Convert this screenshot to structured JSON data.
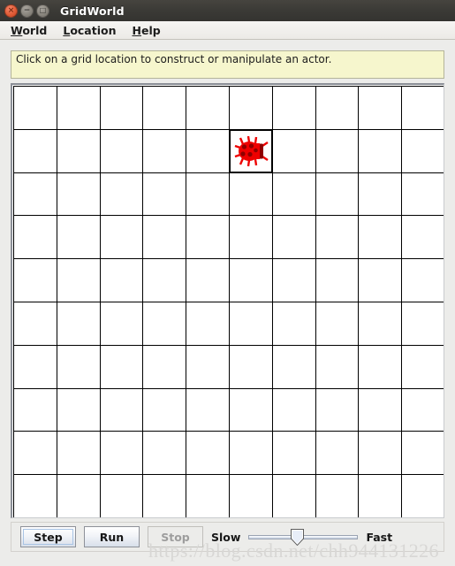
{
  "window": {
    "title": "GridWorld",
    "controls": [
      {
        "name": "close",
        "glyph": "×"
      },
      {
        "name": "minimize",
        "glyph": "−"
      },
      {
        "name": "maximize",
        "glyph": "□"
      }
    ]
  },
  "menubar": {
    "items": [
      {
        "mnemonic": "W",
        "rest": "orld",
        "label": "World"
      },
      {
        "mnemonic": "L",
        "rest": "ocation",
        "label": "Location"
      },
      {
        "mnemonic": "H",
        "rest": "elp",
        "label": "Help"
      }
    ]
  },
  "message_bar": {
    "text": "Click on a grid location to construct or manipulate an actor.",
    "background": "#f6f6cd",
    "border": "#b4b49a"
  },
  "grid": {
    "rows": 10,
    "columns": 10,
    "background": "#ffffff",
    "line_color": "#000000",
    "selected_cell": {
      "row": 1,
      "col": 5
    },
    "actors": [
      {
        "type": "bug",
        "row": 1,
        "col": 5,
        "color": "#ee0000",
        "spot_color": "#8f0000"
      }
    ]
  },
  "controls": {
    "step_label": "Step",
    "run_label": "Run",
    "stop_label": "Stop",
    "stop_enabled": false,
    "step_focused": true,
    "slow_label": "Slow",
    "fast_label": "Fast",
    "slider_value": 44
  },
  "watermark": {
    "text": "https://blog.csdn.net/chh944131226"
  }
}
